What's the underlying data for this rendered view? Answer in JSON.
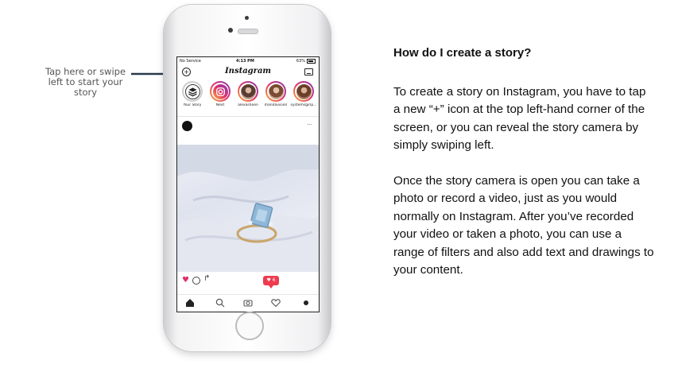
{
  "callout": {
    "text_line1": "Tap here or swipe",
    "text_line2": "left to start your",
    "text_line3": "story"
  },
  "phone": {
    "status": {
      "carrier": "No Service",
      "time": "4:13 PM",
      "battery": "63%"
    },
    "app_title": "Instagram",
    "stories": [
      {
        "label": "Your Story",
        "color": "#444444"
      },
      {
        "label": "Next",
        "color": "#c13584"
      },
      {
        "label": "alexashoen",
        "color": "#6b4a3a"
      },
      {
        "label": "mandavision",
        "color": "#8a5a44"
      },
      {
        "label": "systemsgirlp...",
        "color": "#7a4b33"
      }
    ],
    "post_more": "...",
    "notification_count": "6",
    "icons": {
      "new_story": "plus-circle-icon",
      "inbox": "inbox-icon",
      "like": "heart-icon",
      "comment": "comment-icon",
      "share": "share-icon",
      "home": "home-icon",
      "search": "search-icon",
      "camera": "camera-icon",
      "activity": "heart-outline-icon",
      "profile": "profile-icon"
    }
  },
  "article": {
    "heading": "How do I create a story?",
    "para1": "To create a story on Instagram, you have to tap a new “+” icon at the top left-hand corner of the screen, or you can reveal the story camera by simply swiping left.",
    "para2": "Once the story camera is open you can take a photo or record a video, just as you would normally on Instagram. After you’ve recorded your video or taken a photo, you can use a range of filters and also add text and drawings to your content."
  }
}
